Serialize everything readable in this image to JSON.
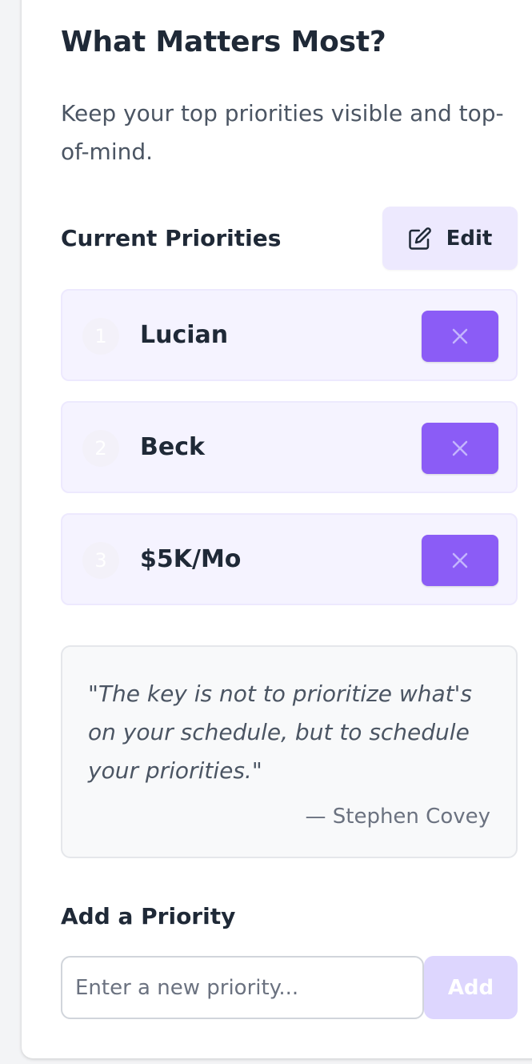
{
  "header": {
    "title": "What Matters Most?",
    "subtitle": "Keep your top priorities visible and top-of-mind."
  },
  "priorities_section": {
    "label": "Current Priorities",
    "edit_label": "Edit",
    "edit_icon": "edit-icon",
    "items": [
      {
        "number": "1",
        "label": "Lucian",
        "remove_icon": "close-icon"
      },
      {
        "number": "2",
        "label": "Beck",
        "remove_icon": "close-icon"
      },
      {
        "number": "3",
        "label": "$5K/Mo",
        "remove_icon": "close-icon"
      }
    ]
  },
  "quote": {
    "text": "\"The key is not to prioritize what's on your schedule, but to schedule your priorities.\"",
    "author": "— Stephen Covey"
  },
  "add_section": {
    "label": "Add a Priority",
    "input_value": "",
    "input_placeholder": "Enter a new priority...",
    "button_label": "Add"
  },
  "colors": {
    "accent": "#8b5cf6",
    "accent_light": "#ede9fe",
    "priority_bg": "#f5f3ff",
    "add_disabled": "#ddd6fe"
  }
}
